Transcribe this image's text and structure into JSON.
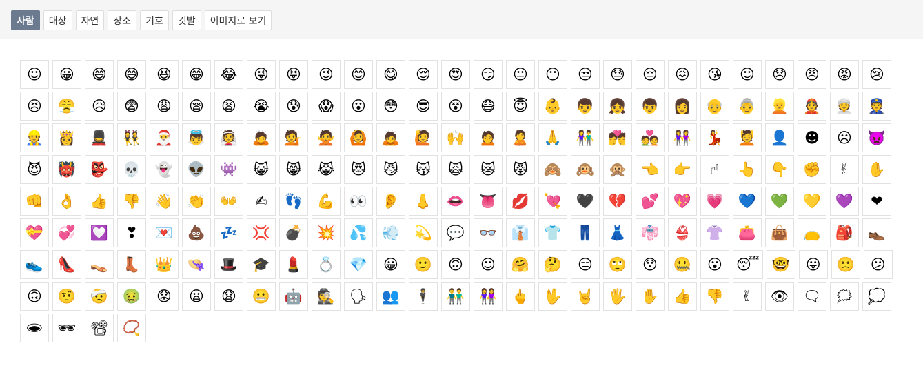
{
  "tabs": [
    {
      "label": "사람",
      "active": true
    },
    {
      "label": "대상",
      "active": false
    },
    {
      "label": "자연",
      "active": false
    },
    {
      "label": "장소",
      "active": false
    },
    {
      "label": "기호",
      "active": false
    },
    {
      "label": "깃발",
      "active": false
    },
    {
      "label": "이미지로 보기",
      "active": false
    }
  ],
  "emojis": [
    "☺",
    "😀",
    "😄",
    "😅",
    "😆",
    "😁",
    "😂",
    "😜",
    "😝",
    "😉",
    "😊",
    "😋",
    "😌",
    "😍",
    "😏",
    "😐",
    "😶",
    "😒",
    "😓",
    "😔",
    "😖",
    "😘",
    "☺",
    "😞",
    "😠",
    "😡",
    "😢",
    "😣",
    "😤",
    "😥",
    "😨",
    "😩",
    "😪",
    "😫",
    "😭",
    "😰",
    "😱",
    "😮",
    "😳",
    "😎",
    "😵",
    "😷",
    "😇",
    "👶",
    "👦",
    "👧",
    "👦",
    "👩",
    "👴",
    "👵",
    "👱",
    "👲",
    "👳",
    "👮",
    "👷",
    "👸",
    "💂",
    "👯",
    "🎅",
    "👼",
    "👰",
    "🙇",
    "💁",
    "🙅",
    "🙆",
    "🙇",
    "🙋",
    "🙌",
    "🙍",
    "🙎",
    "🙏",
    "👫",
    "💏",
    "💑",
    "👭",
    "💃",
    "💆",
    "👤",
    "☻",
    "☹",
    "👿",
    "😈",
    "👹",
    "👺",
    "💀",
    "👻",
    "👽",
    "👾",
    "😺",
    "😸",
    "😹",
    "😻",
    "😼",
    "😽",
    "🙀",
    "😿",
    "😾",
    "🙈",
    "🙉",
    "🙊",
    "👈",
    "👉",
    "☝",
    "👆",
    "👇",
    "✊",
    "✌",
    "✋",
    "👊",
    "👌",
    "👍",
    "👎",
    "👋",
    "👏",
    "👐",
    "✍",
    "👣",
    "💪",
    "👀",
    "👂",
    "👃",
    "👄",
    "👅",
    "💋",
    "💘",
    "🖤",
    "💔",
    "💕",
    "💖",
    "💗",
    "💙",
    "💚",
    "💛",
    "💜",
    "❤",
    "💝",
    "💞",
    "💟",
    "❣",
    "💌",
    "💩",
    "💤",
    "💢",
    "💣",
    "💥",
    "💦",
    "💨",
    "💫",
    "💬",
    "👓",
    "👔",
    "👕",
    "👖",
    "👗",
    "👘",
    "👙",
    "👚",
    "👛",
    "👜",
    "👝",
    "🎒",
    "👞",
    "👟",
    "👠",
    "👡",
    "👢",
    "👑",
    "👒",
    "🎩",
    "🎓",
    "💄",
    "💍",
    "💎",
    "😀",
    "🙂",
    "🙃",
    "☺",
    "🤗",
    "🤔",
    "😑",
    "🙄",
    "😯",
    "🤐",
    "😮",
    "😴",
    "🤓",
    "😛",
    "🙁",
    "😕",
    "🙃",
    "🤨",
    "🤕",
    "🤢",
    "😟",
    "😦",
    "😧",
    "😬",
    "🤖",
    "🕵",
    "🗣",
    "👥",
    "🕴",
    "👬",
    "👭",
    "🖕",
    "🖖",
    "🤘",
    "🖐",
    "✋",
    "👍",
    "👎",
    "✌",
    "👁",
    "🗨",
    "🗯",
    "💭",
    "🕳",
    "🕶",
    "📽",
    "📿"
  ]
}
